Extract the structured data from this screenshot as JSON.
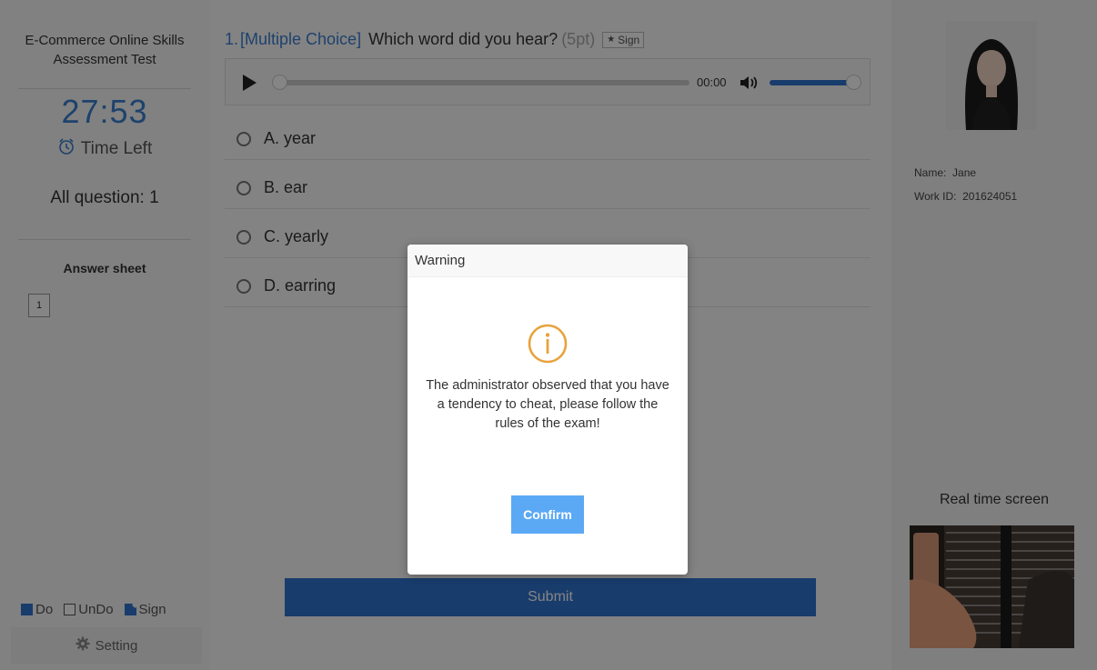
{
  "sidebar": {
    "exam_title": "E-Commerce Online Skills Assessment Test",
    "timer": "27:53",
    "time_left_label": "Time Left",
    "all_questions": "All question: 1",
    "answer_sheet_label": "Answer sheet",
    "question_boxes": [
      "1"
    ],
    "legend": {
      "do": "Do",
      "undo": "UnDo",
      "sign": "Sign"
    },
    "setting_label": "Setting"
  },
  "question": {
    "number": "1.",
    "type": "[Multiple Choice]",
    "text": "Which word did you hear?",
    "points": "(5pt)",
    "sign_label": "Sign",
    "audio": {
      "time": "00:00",
      "progress": 0,
      "volume": 0.9
    },
    "options": [
      {
        "label": "A. year"
      },
      {
        "label": "B. ear"
      },
      {
        "label": "C. yearly"
      },
      {
        "label": "D. earring"
      }
    ],
    "submit_label": "Submit"
  },
  "profile": {
    "name_label": "Name:",
    "name": "Jane",
    "work_id_label": "Work ID:",
    "work_id": "201624051",
    "realtime_label": "Real time screen"
  },
  "modal": {
    "title": "Warning",
    "message": "The administrator observed that you have a tendency to cheat, please follow the rules of the exam!",
    "confirm_label": "Confirm",
    "accent": "#e8a33d",
    "button_color": "#5ba9f5"
  },
  "colors": {
    "primary": "#2f74d0",
    "link": "#3b7fd0"
  }
}
